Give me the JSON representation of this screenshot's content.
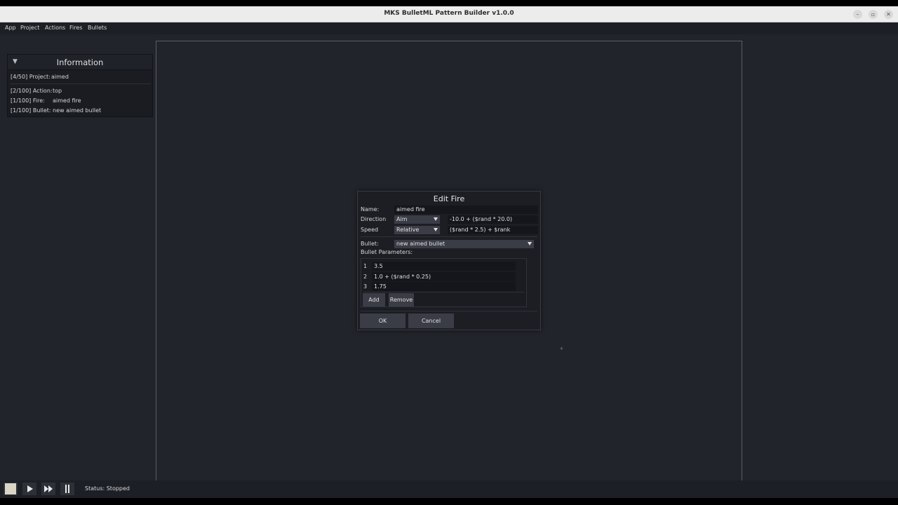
{
  "window": {
    "title": "MKS BulletML Pattern Builder v1.0.0",
    "controls": [
      "minimize-icon",
      "restore-icon",
      "close-icon"
    ]
  },
  "menubar": {
    "items": [
      "App",
      "Project",
      "Actions",
      "Fires",
      "Bullets"
    ]
  },
  "info": {
    "title": "Information",
    "project": {
      "label": "[4/50] Project:",
      "value": "aimed"
    },
    "action": {
      "label": "[2/100] Action:",
      "value": "top"
    },
    "fire": {
      "label": "[1/100] Fire:",
      "value": "aimed fire"
    },
    "bullet": {
      "label": "[1/100] Bullet:",
      "value": "new aimed bullet"
    }
  },
  "dialog": {
    "title": "Edit Fire",
    "name_label": "Name:",
    "name_value": "aimed fire",
    "direction_label": "Direction",
    "direction_type": "Aim",
    "direction_value": "-10.0 + ($rand * 20.0)",
    "speed_label": "Speed",
    "speed_type": "Relative",
    "speed_value": "($rand * 2.5) + $rank",
    "bullet_label": "Bullet:",
    "bullet_value": "new aimed bullet",
    "params_label": "Bullet Parameters:",
    "params": [
      {
        "index": "1",
        "value": "3.5"
      },
      {
        "index": "2",
        "value": "1.0 + ($rand * 0.25)"
      },
      {
        "index": "3",
        "value": "1.75"
      }
    ],
    "add_label": "Add",
    "remove_label": "Remove",
    "ok_label": "OK",
    "cancel_label": "Cancel"
  },
  "status": {
    "text": "Status: Stopped"
  },
  "colors": {
    "background": "#22242b",
    "panel": "#1a1c22",
    "button": "#3a3d46",
    "stop": "#d9d4c6"
  }
}
